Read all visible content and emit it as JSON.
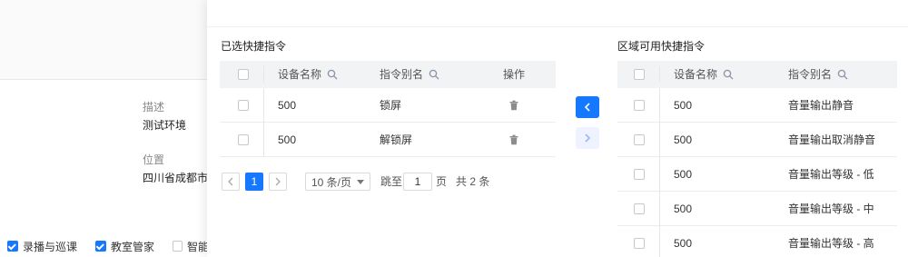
{
  "background": {
    "fields": [
      {
        "label": "描述",
        "value": "测试环境"
      },
      {
        "label": "位置",
        "value": "四川省成都市武"
      }
    ],
    "checkboxes": [
      {
        "label": "录播与巡课",
        "checked": true
      },
      {
        "label": "教室管家",
        "checked": true
      },
      {
        "label": "智能",
        "checked": false
      }
    ]
  },
  "selected_panel": {
    "title": "已选快捷指令",
    "columns": {
      "device": "设备名称",
      "alias": "指令别名",
      "action": "操作"
    },
    "rows": [
      {
        "device": "500",
        "alias": "锁屏"
      },
      {
        "device": "500",
        "alias": "解锁屏"
      }
    ],
    "pagination": {
      "current_page": "1",
      "page_size": "10 条/页",
      "jump_label": "跳至",
      "jump_value": "1",
      "page_unit": "页",
      "total": "共 2 条"
    }
  },
  "available_panel": {
    "title": "区域可用快捷指令",
    "columns": {
      "device": "设备名称",
      "alias": "指令别名"
    },
    "rows": [
      {
        "device": "500",
        "alias": "音量输出静音"
      },
      {
        "device": "500",
        "alias": "音量输出取消静音"
      },
      {
        "device": "500",
        "alias": "音量输出等级 - 低"
      },
      {
        "device": "500",
        "alias": "音量输出等级 - 中"
      },
      {
        "device": "500",
        "alias": "音量输出等级 - 高"
      }
    ]
  },
  "icons": {
    "search": "search-icon",
    "trash": "trash-icon",
    "move_left": "chevron-left-icon",
    "move_right": "chevron-right-icon"
  },
  "colors": {
    "accent": "#1677ff",
    "header_bg": "#f2f3f5"
  }
}
